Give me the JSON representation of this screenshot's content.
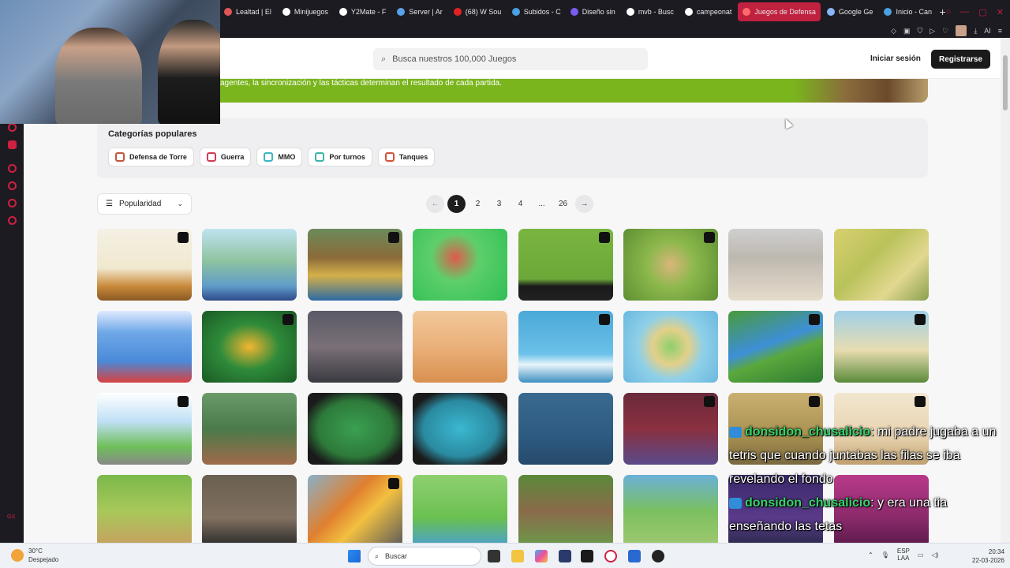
{
  "browser": {
    "tabs": [
      {
        "label": "Lealtad | El",
        "color": "#e05555"
      },
      {
        "label": "Minijuegos",
        "color": "#ffffff"
      },
      {
        "label": "Y2Mate - F",
        "color": "#ffffff"
      },
      {
        "label": "Server | Ar",
        "color": "#5aa0e8"
      },
      {
        "label": "(68) W Sou",
        "color": "#e22222"
      },
      {
        "label": "Subidos - C",
        "color": "#4aa0e0"
      },
      {
        "label": "Diseño sin",
        "color": "#7a5cf0"
      },
      {
        "label": "mvb - Busc",
        "color": "#ffffff"
      },
      {
        "label": "campeonat",
        "color": "#ffffff"
      },
      {
        "label": "Juegos de Defensa",
        "color": "#ff6b6b",
        "active": true
      },
      {
        "label": "Google Ge",
        "color": "#8ab4f8"
      },
      {
        "label": "Inicio - Can",
        "color": "#4aa0e0"
      }
    ]
  },
  "header": {
    "search_placeholder": "Busca nuestros 100,000 Juegos",
    "login": "Iniciar sesión",
    "register": "Registrarse"
  },
  "banner": {
    "text": "agentes, la sincronización y las tácticas determinan el resultado de cada partida."
  },
  "categories": {
    "title": "Categorías populares",
    "items": [
      {
        "label": "Defensa de Torre",
        "color": "#c4563f"
      },
      {
        "label": "Guerra",
        "color": "#d43a55"
      },
      {
        "label": "MMO",
        "color": "#3bb5c6"
      },
      {
        "label": "Por turnos",
        "color": "#3bb5a4"
      },
      {
        "label": "Tanques",
        "color": "#d4553a"
      }
    ]
  },
  "sort": {
    "label": "Popularidad"
  },
  "pagination": {
    "prev": "←",
    "pages": [
      "1",
      "2",
      "3",
      "4",
      "...",
      "26"
    ],
    "current": "1",
    "next": "→"
  },
  "games": [
    {
      "bg": "linear-gradient(180deg,#f4f0e4 0%,#f1e8cf 55%,#c98a3a 80%,#8a5a22 100%)",
      "badge": true
    },
    {
      "bg": "linear-gradient(180deg,#bfe3f0 0%,#8ec3a0 45%,#5f9bc8 80%,#2d4a8a 100%)",
      "badge": false
    },
    {
      "bg": "linear-gradient(180deg,#6b8a5a 0%,#8b6b3a 40%,#d4b04a 65%,#2d6aa3 100%)",
      "badge": true
    },
    {
      "bg": "radial-gradient(circle at 45% 40%,#e05a4a 0%,#5ecf6a 35%,#2fbf55 100%)",
      "badge": false
    },
    {
      "bg": "linear-gradient(180deg,#7ab540 0%,#6ba838 70%,#1a1a1a 80%,#222 100%)",
      "badge": true
    },
    {
      "bg": "radial-gradient(circle at 50% 50%,#d9b57a 0%,#8cb84c 40%,#5e8f32 100%)",
      "badge": true
    },
    {
      "bg": "linear-gradient(180deg,#cfcfcf 0%,#bdb8b0 40%,#e6dccb 100%)",
      "badge": false
    },
    {
      "bg": "linear-gradient(135deg,#d8d070 0%,#b9c25a 40%,#e2d890 70%,#8aa050 100%)",
      "badge": false
    },
    {
      "bg": "linear-gradient(180deg,#dfe9ff 0%,#6fa8e8 30%,#4a8ad8 70%,#d94040 100%)",
      "badge": false
    },
    {
      "bg": "radial-gradient(ellipse at 50% 50%,#f2b530 0%,#2e8b3a 45%,#1a5a24 100%)",
      "badge": true
    },
    {
      "bg": "linear-gradient(180deg,#5a5a66 0%,#7a7078 50%,#3a3a40 100%)",
      "badge": false
    },
    {
      "bg": "linear-gradient(180deg,#f2c89a 0%,#eab07a 50%,#d8904f 100%)",
      "badge": false
    },
    {
      "bg": "linear-gradient(180deg,#4aa8d8 0%,#6bc1e8 60%,#e8f4fa 75%,#3d8fc0 100%)",
      "badge": true
    },
    {
      "bg": "radial-gradient(circle at 50% 50%,#8fcf6a 0%,#e2d08a 30%,#8fd0e8 55%,#6ab8e0 100%)",
      "badge": false
    },
    {
      "bg": "linear-gradient(160deg,#4a9a3a 0%,#3d8fd8 45%,#5aa83d 60%,#2d7a30 100%)",
      "badge": true
    },
    {
      "bg": "linear-gradient(180deg,#9fd0e8 0%,#e8dcb0 55%,#5a8a3a 100%)",
      "badge": true
    },
    {
      "bg": "linear-gradient(180deg,#ffffff 0%,#bfe0f5 40%,#6fbf5a 75%,#888 100%)",
      "badge": true
    },
    {
      "bg": "linear-gradient(180deg,#6a9a6a 0%,#4a7a4a 50%,#a06a4a 100%)",
      "badge": false
    },
    {
      "bg": "radial-gradient(ellipse at 50% 50%,#3aa050 0%,#2d7a3a 55%,#1a1a1a 80%)",
      "badge": false
    },
    {
      "bg": "radial-gradient(ellipse at 50% 50%,#3ab8d0 0%,#2a8aa0 55%,#1a1a1a 80%)",
      "badge": false
    },
    {
      "bg": "linear-gradient(180deg,#3a6a90 0%,#2d5a80 60%,#264a6a 100%)",
      "badge": false
    },
    {
      "bg": "linear-gradient(180deg,#6a2a3a 0%,#8a3040 50%,#5a4a8a 100%)",
      "badge": true
    },
    {
      "bg": "linear-gradient(180deg,#c9b070 0%,#a89050 60%,#7a6a40 100%)",
      "badge": true
    },
    {
      "bg": "linear-gradient(180deg,#f2e6d0 0%,#e8d4b0 60%,#c0a070 100%)",
      "badge": true
    },
    {
      "bg": "linear-gradient(180deg,#7ab84a 0%,#a8c85a 50%,#c8a060 100%)",
      "badge": false
    },
    {
      "bg": "linear-gradient(180deg,#6a6050 0%,#807060 60%,#2a2a2a 100%)",
      "badge": false
    },
    {
      "bg": "linear-gradient(135deg,#8ab0c8 0%,#e08030 40%,#f2c040 60%,#5a5a5a 100%)",
      "badge": true
    },
    {
      "bg": "linear-gradient(180deg,#8fd070 0%,#6ac050 60%,#4aa0d0 100%)",
      "badge": false
    },
    {
      "bg": "linear-gradient(180deg,#5a8a3a 0%,#8a6a4a 50%,#6a9a4a 100%)",
      "badge": false
    },
    {
      "bg": "linear-gradient(180deg,#6ab0d8 0%,#7ac060 50%,#a0c870 100%)",
      "badge": false
    },
    {
      "bg": "linear-gradient(180deg,#3a2a6a 0%,#5a3a8a 60%,#2a2a4a 100%)",
      "badge": false
    },
    {
      "bg": "linear-gradient(180deg,#b83a8a 0%,#8a2a6a 60%,#5a1a4a 100%)",
      "badge": false
    }
  ],
  "chat": [
    {
      "user": "donsidon_chusalicio",
      "message": ": mi padre jugaba a un tetris que cuando juntabas las filas se iba revelando el fondo"
    },
    {
      "user": "donsidon_chusalicio",
      "message": ": y era una tia enseñando las tetas"
    }
  ],
  "taskbar": {
    "temperature": "30°C",
    "weather": "Despejado",
    "search": "Buscar",
    "language_top": "ESP",
    "language_bottom": "LAA",
    "time": "20:34",
    "date": "22-03-2026"
  }
}
